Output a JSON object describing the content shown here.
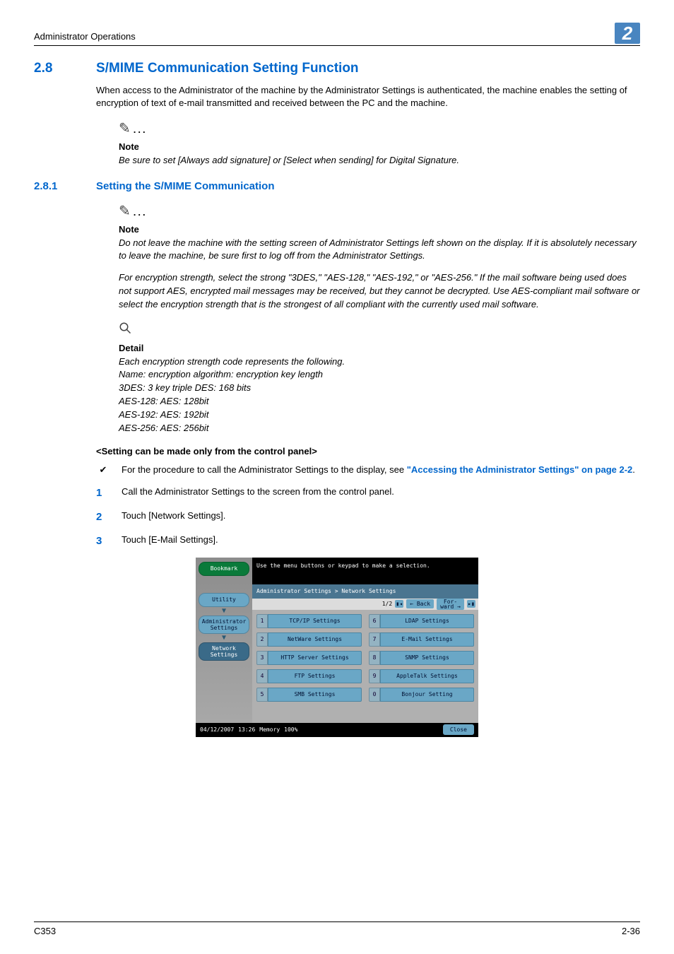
{
  "header": {
    "title": "Administrator Operations",
    "chapter": "2"
  },
  "section": {
    "num": "2.8",
    "title": "S/MIME Communication Setting Function",
    "intro": "When access to the Administrator of the machine by the Administrator Settings is authenticated, the machine enables the setting of encryption of text of e-mail transmitted and received between the PC and the machine."
  },
  "note1": {
    "label": "Note",
    "text": "Be sure to set [Always add signature] or [Select when sending] for Digital Signature."
  },
  "subsection": {
    "num": "2.8.1",
    "title": "Setting the S/MIME Communication"
  },
  "note2": {
    "label": "Note",
    "p1": "Do not leave the machine with the setting screen of Administrator Settings left shown on the display. If it is absolutely necessary to leave the machine, be sure first to log off from the Administrator Settings.",
    "p2": "For encryption strength, select the strong \"3DES,\" \"AES-128,\" \"AES-192,\" or \"AES-256.\" If the mail software being used does not support AES, encrypted mail messages may be received, but they cannot be decrypted. Use AES-compliant mail software or select the encryption strength that is the strongest of all compliant with the currently used mail software."
  },
  "detail": {
    "label": "Detail",
    "lines": [
      "Each encryption strength code represents the following.",
      "Name: encryption algorithm: encryption key length",
      "3DES: 3 key triple DES: 168 bits",
      "AES-128: AES: 128bit",
      "AES-192: AES: 192bit",
      "AES-256: AES: 256bit"
    ]
  },
  "panelhead": "<Setting can be made only from the control panel>",
  "proc": {
    "lead": "For the procedure to call the Administrator Settings to the display, see ",
    "link": "\"Accessing the Administrator Settings\" on page 2-2",
    "tail": "."
  },
  "steps": [
    "Call the Administrator Settings to the screen from the control panel.",
    "Touch [Network Settings].",
    "Touch [E-Mail Settings]."
  ],
  "panel": {
    "hint": "Use the menu buttons or keypad to make a selection.",
    "crumb": "Administrator Settings > Network Settings",
    "page": "1/2",
    "back": "Back",
    "forward": "For-\nward",
    "side": {
      "bookmark": "Bookmark",
      "utility": "Utility",
      "admin": "Administrator\nSettings",
      "network": "Network\nSettings"
    },
    "items": [
      {
        "n": "1",
        "label": "TCP/IP Settings"
      },
      {
        "n": "6",
        "label": "LDAP Settings"
      },
      {
        "n": "2",
        "label": "NetWare Settings"
      },
      {
        "n": "7",
        "label": "E-Mail Settings"
      },
      {
        "n": "3",
        "label": "HTTP Server Settings"
      },
      {
        "n": "8",
        "label": "SNMP Settings"
      },
      {
        "n": "4",
        "label": "FTP Settings"
      },
      {
        "n": "9",
        "label": "AppleTalk Settings"
      },
      {
        "n": "5",
        "label": "SMB Settings"
      },
      {
        "n": "0",
        "label": "Bonjour Setting"
      }
    ],
    "date": "04/12/2007",
    "time": "13:26",
    "memlabel": "Memory",
    "memval": "100%",
    "close": "Close"
  },
  "footer": {
    "model": "C353",
    "page": "2-36"
  }
}
